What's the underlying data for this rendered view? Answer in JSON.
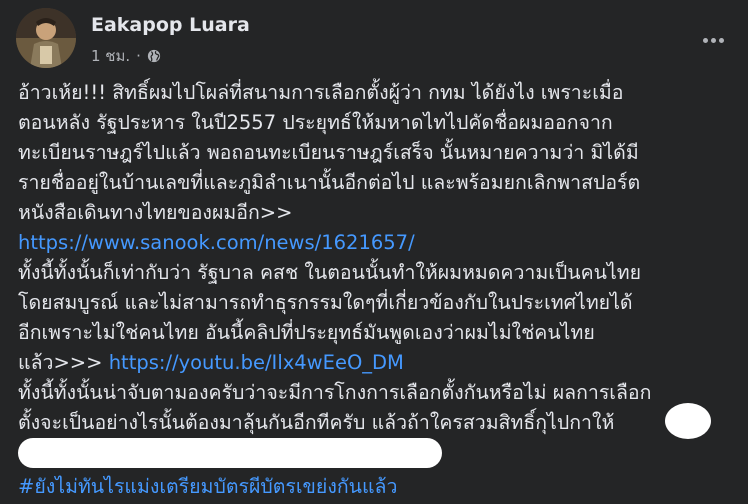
{
  "post": {
    "author": "Eakapop Luara",
    "time": "1 ชม.",
    "separator": "·",
    "privacy_icon": "globe-icon",
    "more_icon": "more-horizontal-icon",
    "body": {
      "line1": "อ้าวเห้ย!!! สิทธิ์ผมไปโผล่ที่สนามการเลือกตั้งผู้ว่า กทม ได้ยังไง เพราะเมื่อ",
      "line2": "ตอนหลัง รัฐประหาร ในปี2557 ประยุทธ์ให้มหาดไทไปคัดชื่อผมออกจาก",
      "line3": "ทะเบียนราษฎร์ไปแล้ว พอถอนทะเบียนราษฎร์เสร็จ นั้นหมายความว่า มิได้มี",
      "line4": "รายชื่ออยู่ในบ้านเลขที่และภูมิลำเนานั้นอีกต่อไป และพร้อมยกเลิกพาสปอร์ต",
      "line5": "หนังสือเดินทางไทยของผมอีก>>",
      "link1": "https://www.sanook.com/news/1621657/",
      "line7": " ทั้งนี้ทั้งนั้นก็เท่ากับว่า รัฐบาล คสช ในตอนนั้นทำให้ผมหมดความเป็นคนไทย",
      "line8": "โดยสมบูรณ์ และไม่สามารถทำธุรกรรมใดๆที่เกี่ยวข้องกับในประเทศไทยได้",
      "line9": "อีกเพราะไม่ใช่คนไทย อันนี้คลิปที่ประยุทธ์มันพูดเองว่าผมไม่ใช่คนไทย",
      "line10_prefix": "แล้ว>>> ",
      "link2": "https://youtu.be/Ilx4wEeO_DM",
      "line11": "  ทั้งนี้ทั้งนั้นน่าจับตามองครับว่าจะมีการโกงการเลือกตั้งกันหรือไม่ ผลการเลือก",
      "line12": "ตั้งจะเป็นอย่างไรนั้นต้องมาลุ้นกันอีกทีครับ แล้วถ้าใครสวมสิทธิ์กุไปกาให้"
    },
    "hashtag": "#ยังไม่ทันไรแม่งเตรียมบัตรผีบัตรเขย่งกันแล้ว"
  }
}
